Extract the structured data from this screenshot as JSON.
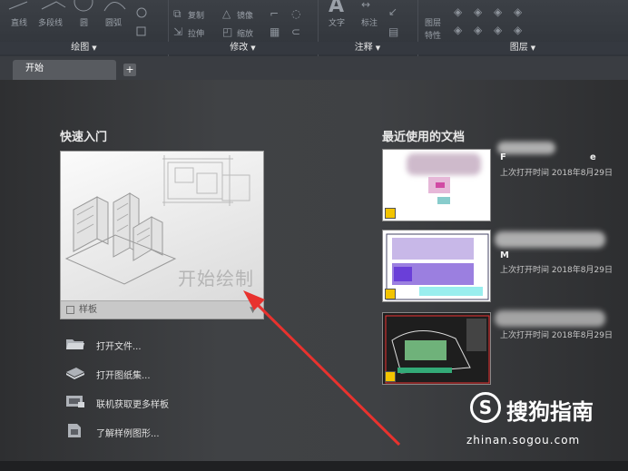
{
  "ribbon": {
    "groups": [
      {
        "label": "绘图"
      },
      {
        "label": "修改"
      },
      {
        "label": "注释"
      },
      {
        "label": "图层"
      }
    ],
    "draw_tools": [
      "直线",
      "多段线",
      "圆",
      "圆弧"
    ],
    "modify_tools": [
      "复制",
      "镜像",
      "拉伸",
      "缩放"
    ],
    "annot_tools": [
      "文字",
      "标注"
    ],
    "layer_tools": [
      "图层",
      "特性"
    ]
  },
  "tabs": {
    "active": "开始",
    "add_symbol": "+"
  },
  "quick_start": {
    "heading": "快速入门",
    "start_drawing": "开始绘制",
    "template_label": "样板",
    "links": [
      {
        "label": "打开文件...",
        "icon": "folder-icon"
      },
      {
        "label": "打开图纸集...",
        "icon": "sheetset-icon"
      },
      {
        "label": "联机获取更多样板",
        "icon": "online-template-icon"
      },
      {
        "label": "了解样例图形...",
        "icon": "sample-drawing-icon"
      }
    ]
  },
  "recent": {
    "heading": "最近使用的文档",
    "docs": [
      {
        "title": "F",
        "title_tail": "e",
        "date": "上次打开时间 2018年8月29日"
      },
      {
        "title": "M",
        "title_tail": "",
        "date": "上次打开时间 2018年8月29日"
      },
      {
        "title": "",
        "title_tail": "",
        "date": "上次打开时间 2018年8月29日"
      }
    ]
  },
  "watermark": {
    "brand": "搜狗指南",
    "letter": "S",
    "url": "zhinan.sogou.com"
  },
  "colors": {
    "arrow": "#e8322e",
    "accent": "#f3c400"
  }
}
